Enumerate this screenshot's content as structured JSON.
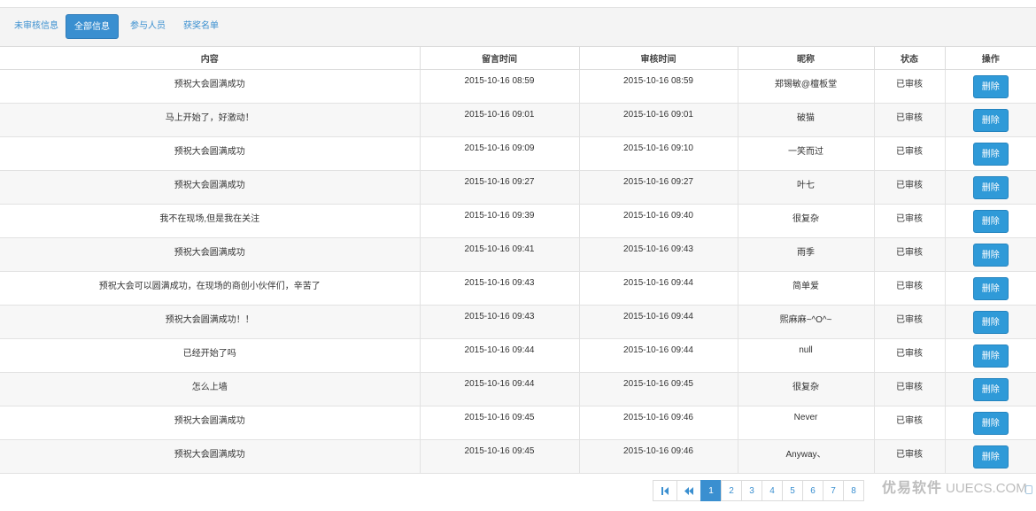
{
  "tabs": [
    {
      "label": "未审核信息",
      "active": false
    },
    {
      "label": "全部信息",
      "active": true
    },
    {
      "label": "参与人员",
      "active": false
    },
    {
      "label": "获奖名单",
      "active": false
    }
  ],
  "table": {
    "headers": [
      "内容",
      "留言时间",
      "审核时间",
      "昵称",
      "状态",
      "操作"
    ],
    "rows": [
      {
        "content": "预祝大会圆满成功",
        "msg_time": "2015-10-16 08:59",
        "review_time": "2015-10-16 08:59",
        "nickname": "郑锡敏@檀板堂",
        "status": "已审核",
        "action": "删除"
      },
      {
        "content": "马上开始了，好激动！",
        "msg_time": "2015-10-16 09:01",
        "review_time": "2015-10-16 09:01",
        "nickname": "破猫",
        "status": "已审核",
        "action": "删除"
      },
      {
        "content": "预祝大会圆满成功",
        "msg_time": "2015-10-16 09:09",
        "review_time": "2015-10-16 09:10",
        "nickname": "一笑而过",
        "status": "已审核",
        "action": "删除"
      },
      {
        "content": "预祝大会圆满成功",
        "msg_time": "2015-10-16 09:27",
        "review_time": "2015-10-16 09:27",
        "nickname": "叶七",
        "status": "已审核",
        "action": "删除"
      },
      {
        "content": "我不在现场,但是我在关注",
        "msg_time": "2015-10-16 09:39",
        "review_time": "2015-10-16 09:40",
        "nickname": "很复杂",
        "status": "已审核",
        "action": "删除"
      },
      {
        "content": "预祝大会圆满成功",
        "msg_time": "2015-10-16 09:41",
        "review_time": "2015-10-16 09:43",
        "nickname": "雨季",
        "status": "已审核",
        "action": "删除"
      },
      {
        "content": "预祝大会可以圆满成功，在现场的商创小伙伴们，辛苦了",
        "msg_time": "2015-10-16 09:43",
        "review_time": "2015-10-16 09:44",
        "nickname": "简单爱",
        "status": "已审核",
        "action": "删除"
      },
      {
        "content": "预祝大会圆满成功！！",
        "msg_time": "2015-10-16 09:43",
        "review_time": "2015-10-16 09:44",
        "nickname": "熙麻麻~^O^~",
        "status": "已审核",
        "action": "删除"
      },
      {
        "content": "已经开始了吗",
        "msg_time": "2015-10-16 09:44",
        "review_time": "2015-10-16 09:44",
        "nickname": "null",
        "status": "已审核",
        "action": "删除"
      },
      {
        "content": "怎么上墙",
        "msg_time": "2015-10-16 09:44",
        "review_time": "2015-10-16 09:45",
        "nickname": "很复杂",
        "status": "已审核",
        "action": "删除"
      },
      {
        "content": "预祝大会圆满成功",
        "msg_time": "2015-10-16 09:45",
        "review_time": "2015-10-16 09:46",
        "nickname": "Never",
        "status": "已审核",
        "action": "删除"
      },
      {
        "content": "预祝大会圆满成功",
        "msg_time": "2015-10-16 09:45",
        "review_time": "2015-10-16 09:46",
        "nickname": "Anyway、",
        "status": "已审核",
        "action": "删除"
      }
    ]
  },
  "pagination": {
    "first_icon": "first-page-icon",
    "prev_icon": "prev-page-icon",
    "pages": [
      "1",
      "2",
      "3",
      "4",
      "5",
      "6",
      "7",
      "8"
    ],
    "current": "1"
  },
  "watermark": {
    "cn": "优易软件",
    "en": "UUECS.COM"
  },
  "colors": {
    "accent": "#3a8fd0",
    "button": "#2f9ad8"
  }
}
